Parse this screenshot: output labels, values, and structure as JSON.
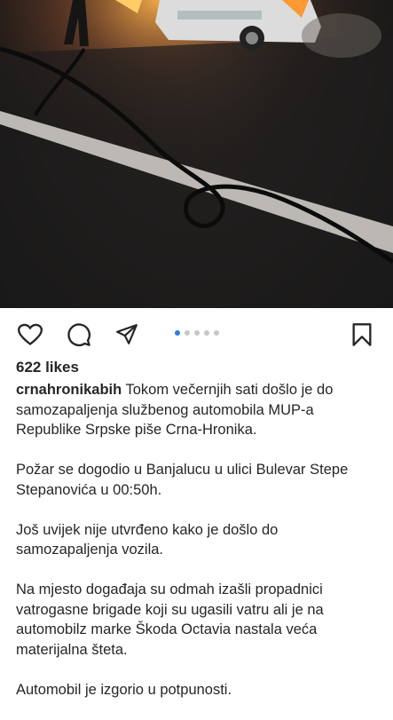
{
  "post": {
    "image_alt_icon": "burning-police-car-photo",
    "carousel": {
      "total": 5,
      "active_index": 0
    },
    "likes_text": "622 likes",
    "username": "crnahronikabih",
    "caption_first": "Tokom večernjih sati došlo je do samozapaljenja službenog automobila MUP-a Republike Srpske piše Crna-Hronika.",
    "paragraphs": [
      "Požar se dogodio u Banjalucu u ulici Bulevar Stepe Stepanovića u 00:50h.",
      "Još uvijek nije utvrđeno kako je došlo do samozapaljenja vozila.",
      "Na mjesto događaja su odmah izašli propadnici vatrogasne brigade koji su ugasili vatru ali je na automobilz marke Škoda Octavia nastala veća materijalna šteta.",
      "Automobil je izgorio u potpunosti."
    ]
  },
  "icons": {
    "like": "heart-icon",
    "comment": "comment-icon",
    "share": "send-icon",
    "save": "bookmark-icon"
  },
  "colors": {
    "accent": "#2a7de1",
    "dot_inactive": "#c7c7c7"
  }
}
